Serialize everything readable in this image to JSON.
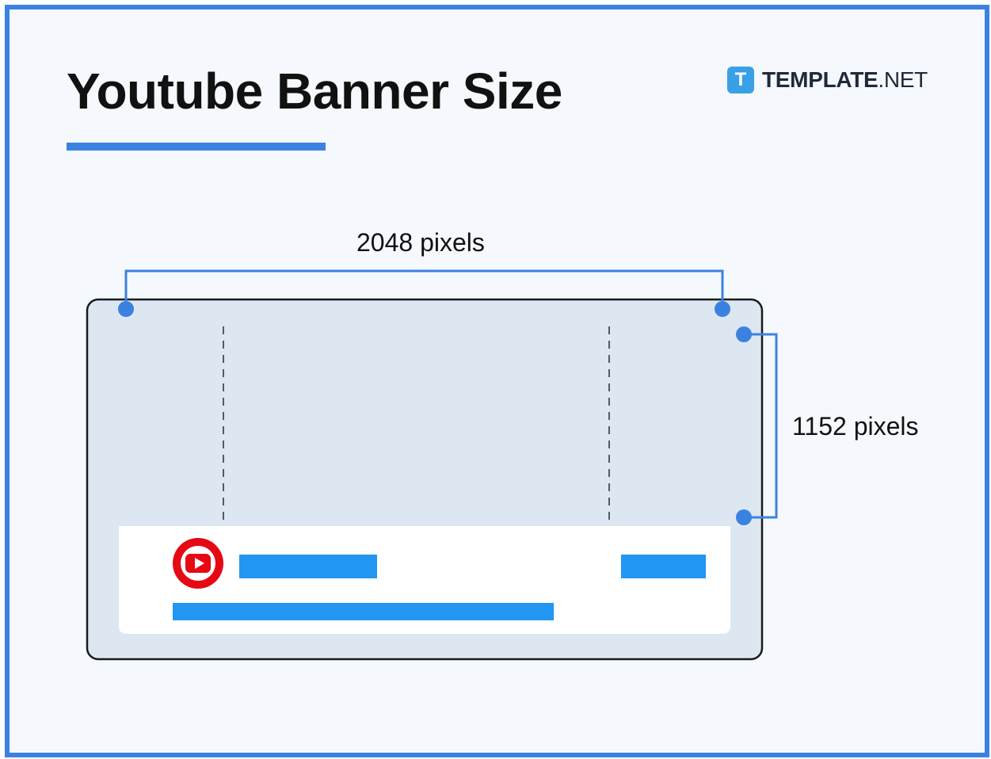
{
  "title": "Youtube Banner Size",
  "brand": {
    "logo_letter": "T",
    "name_bold": "TEMPLATE",
    "name_regular": ".NET"
  },
  "dimensions": {
    "width_label": "2048 pixels",
    "height_label": "1152 pixels"
  },
  "icons": {
    "brand": "template-logo-icon",
    "channel": "youtube-play-icon",
    "photo": "banner-photo-woman-sunglasses"
  },
  "colors": {
    "accent": "#3b82e0",
    "placeholder_bar": "#2196f3",
    "youtube_red": "#e50914",
    "photo_yellow": "#e6c553",
    "device_fill": "#dde7f2"
  }
}
